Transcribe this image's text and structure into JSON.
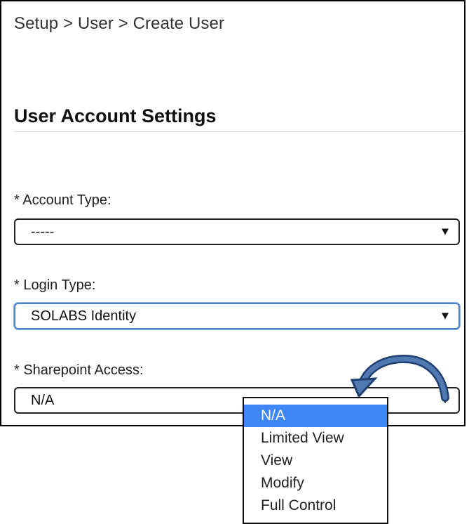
{
  "breadcrumb": "Setup > User > Create User",
  "section_title": "User Account Settings",
  "fields": {
    "account_type": {
      "label": "* Account Type:",
      "value": "-----"
    },
    "login_type": {
      "label": "* Login Type:",
      "value": "SOLABS Identity"
    },
    "sharepoint_access": {
      "label": "* Sharepoint Access:",
      "value": "N/A",
      "options": [
        "N/A",
        "Limited View",
        "View",
        "Modify",
        "Full Control"
      ]
    }
  },
  "colors": {
    "focused_border": "#4c84c8",
    "selected_option_bg": "#3f86f7",
    "annotation_arrow": "#1f3f70"
  },
  "icons": {
    "select_caret": "chevron-down-icon",
    "annotation": "curved-arrow-icon"
  }
}
